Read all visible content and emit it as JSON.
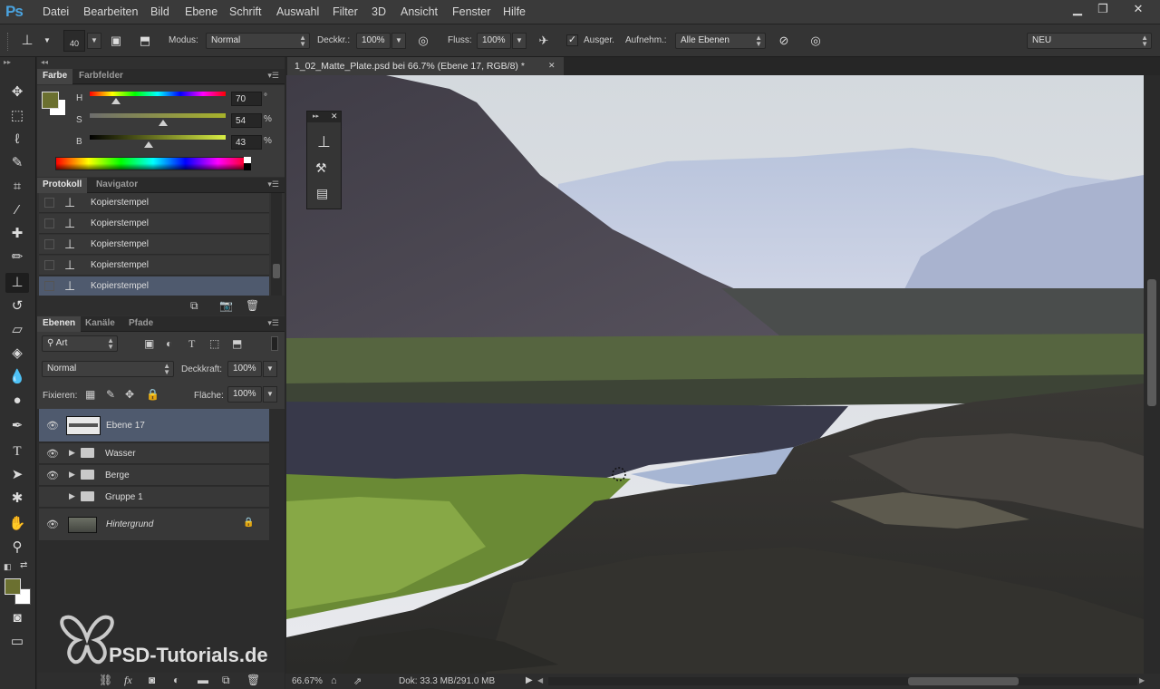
{
  "app": {
    "logo": "Ps"
  },
  "menu": [
    "Datei",
    "Bearbeiten",
    "Bild",
    "Ebene",
    "Schrift",
    "Auswahl",
    "Filter",
    "3D",
    "Ansicht",
    "Fenster",
    "Hilfe"
  ],
  "window_controls": {
    "minimize": "▁",
    "restore": "❐",
    "close": "✕"
  },
  "options": {
    "brush_size": "40",
    "mode_label": "Modus:",
    "mode_value": "Normal",
    "opacity_label": "Deckkr.:",
    "opacity_value": "100%",
    "flow_label": "Fluss:",
    "flow_value": "100%",
    "aligned_label": "Ausger.",
    "sample_label": "Aufnehm.:",
    "sample_value": "Alle Ebenen",
    "workspace": "NEU"
  },
  "color_panel": {
    "tabs": [
      "Farbe",
      "Farbfelder"
    ],
    "h_label": "H",
    "h_value": "70",
    "h_unit": "°",
    "s_label": "S",
    "s_value": "54",
    "s_unit": "%",
    "b_label": "B",
    "b_value": "43",
    "b_unit": "%",
    "h_level": 0.19,
    "s_level": 0.54,
    "b_level": 0.43,
    "foreground": "#6b7030",
    "background": "#ffffff"
  },
  "history_panel": {
    "tabs": [
      "Protokoll",
      "Navigator"
    ],
    "items": [
      "Kopierstempel",
      "Kopierstempel",
      "Kopierstempel",
      "Kopierstempel",
      "Kopierstempel"
    ]
  },
  "layers_panel": {
    "tabs": [
      "Ebenen",
      "Kanäle",
      "Pfade"
    ],
    "filter_kind": "Art",
    "blend_mode": "Normal",
    "opacity_label": "Deckkraft:",
    "opacity_value": "100%",
    "lock_label": "Fixieren:",
    "fill_label": "Fläche:",
    "fill_value": "100%",
    "layers": [
      {
        "name": "Ebene 17"
      },
      {
        "name": "Wasser"
      },
      {
        "name": "Berge"
      },
      {
        "name": "Gruppe 1"
      },
      {
        "name": "Hintergrund"
      }
    ]
  },
  "document": {
    "tab_title": "1_02_Matte_Plate.psd bei 66.7% (Ebene 17, RGB/8) *",
    "tab_close": "✕"
  },
  "status": {
    "zoom": "66.67%",
    "doc_info": "Dok: 33.3 MB/291.0 MB"
  },
  "watermark": {
    "text": "PSD-Tutorials.de"
  }
}
